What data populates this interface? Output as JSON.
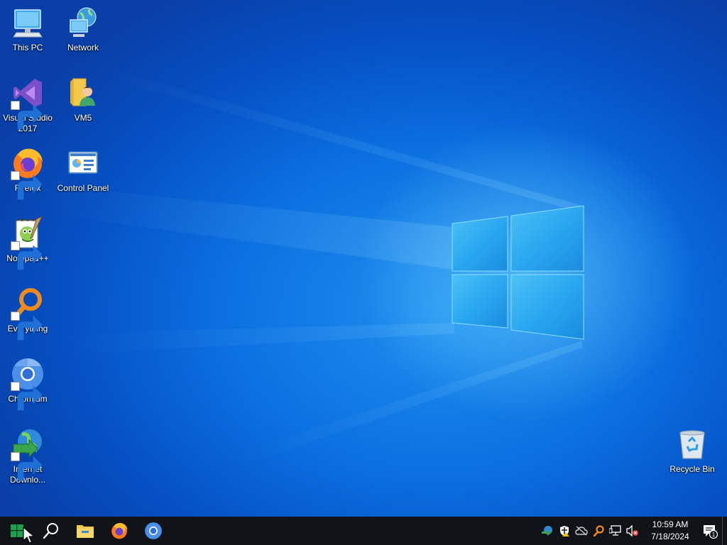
{
  "desktop": {
    "icons": [
      {
        "label": "This PC"
      },
      {
        "label": "Network"
      },
      {
        "label": "Visual Studio 2017"
      },
      {
        "label": "VM5"
      },
      {
        "label": "Firefox"
      },
      {
        "label": "Control Panel"
      },
      {
        "label": "Notepad++"
      },
      {
        "label": "Everything"
      },
      {
        "label": "Chromium"
      },
      {
        "label": "Internet Downlo..."
      },
      {
        "label": "Recycle Bin"
      }
    ]
  },
  "taskbar": {
    "pinned": [
      "windows-start-icon",
      "search-icon",
      "file-explorer-icon",
      "firefox-icon",
      "chromium-icon"
    ],
    "tray_icons": [
      "network-sync-icon",
      "security-shield-icon",
      "cloud-icon",
      "search-everything-icon",
      "network-icon",
      "volume-muted-icon"
    ],
    "clock": {
      "time": "10:59 AM",
      "date": "7/18/2024"
    },
    "notifications": {
      "count": "1"
    }
  },
  "colors": {
    "accent": "#0a6fe0",
    "taskbar": "#101418",
    "logo_glow": "#7fd6ff"
  }
}
